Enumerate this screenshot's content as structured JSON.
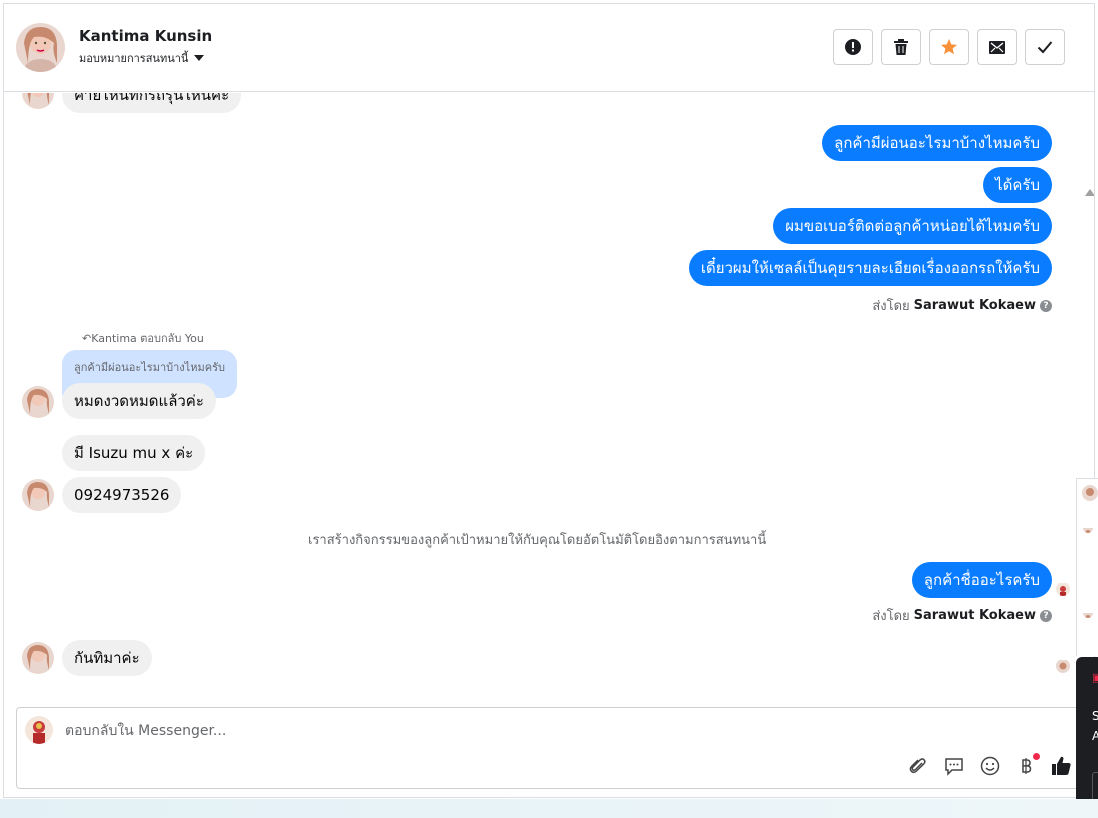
{
  "header": {
    "contact_name": "Kantima Kunsin",
    "assign_label": "มอบหมายการสนทนานี้",
    "actions": [
      {
        "name": "spam-button",
        "icon": "alert-icon"
      },
      {
        "name": "delete-button",
        "icon": "trash-icon"
      },
      {
        "name": "star-button",
        "icon": "star-icon",
        "active_color": "#f7923b"
      },
      {
        "name": "mark-unread-button",
        "icon": "envelope-icon"
      },
      {
        "name": "done-button",
        "icon": "check-icon"
      }
    ]
  },
  "messages": {
    "partial_top_text": "ค่ายไหนทักรถรุ่นไหนค่ะ",
    "out_group1": [
      "ลูกค้ามีผ่อนอะไรมาบ้างไหมครับ",
      "ได้ครับ",
      "ผมขอเบอร์ติดต่อลูกค้าหน่อยได้ไหมครับ",
      "เดี๋ยวผมให้เซลล์เป็นคุยรายละเอียดเรื่องออกรถให้ครับ"
    ],
    "sent_by_prefix": "ส่งโดย",
    "sent_by_name": "Sarawut Kokaew",
    "reply_header": "Kantima ตอบกลับ You",
    "reply_quoted": "ลูกค้ามีผ่อนอะไรมาบ้างไหมครับ",
    "in_group1": [
      "หมดงวดหมดแล้วค่ะ",
      "มี Isuzu mu x ค่ะ",
      "0924973526"
    ],
    "system_note": "เราสร้างกิจกรรมของลูกค้าเป้าหมายให้กับคุณโดยอัตโนมัติโดยอิงตามการสนทนานี้",
    "out_group2": [
      "ลูกค้าชื่ออะไรครับ"
    ],
    "in_group2": [
      "กันทิมาค่ะ"
    ]
  },
  "composer": {
    "placeholder": "ตอบกลับใน Messenger...",
    "tools": [
      "paperclip-icon",
      "quick-reply-icon",
      "emoji-icon",
      "baht-icon",
      "thumbs-up-icon"
    ]
  },
  "side_panel": {
    "dark_lines": [
      "S",
      "A"
    ]
  },
  "colors": {
    "outgoing_bubble": "#0a7cff",
    "incoming_bubble": "#f0f0f0",
    "quoted_bubble": "#cfe2ff"
  }
}
